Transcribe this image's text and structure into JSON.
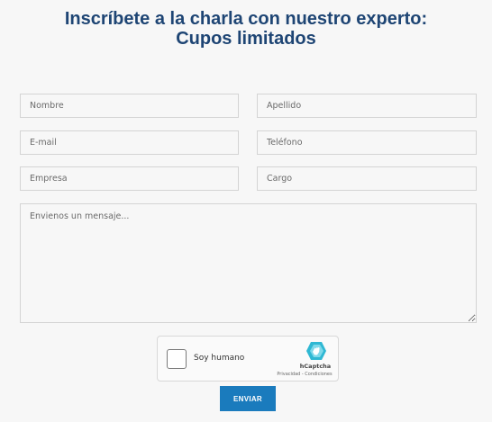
{
  "header": {
    "title_line1": "Inscríbete a la charla con nuestro experto:",
    "title_line2": "Cupos limitados"
  },
  "form": {
    "first_name_placeholder": "Nombre",
    "last_name_placeholder": "Apellido",
    "email_placeholder": "E-mail",
    "phone_placeholder": "Teléfono",
    "company_placeholder": "Empresa",
    "position_placeholder": "Cargo",
    "message_placeholder": "Envienos un mensaje..."
  },
  "captcha": {
    "label": "Soy humano",
    "brand": "hCaptcha",
    "links": "Privacidad - Condiciones",
    "icon": "hcaptcha-logo-icon",
    "checked": false
  },
  "submit": {
    "label": "ENVIAR"
  },
  "colors": {
    "title": "#1e4574",
    "button": "#1a7bbd",
    "background": "#f7f7f7"
  }
}
